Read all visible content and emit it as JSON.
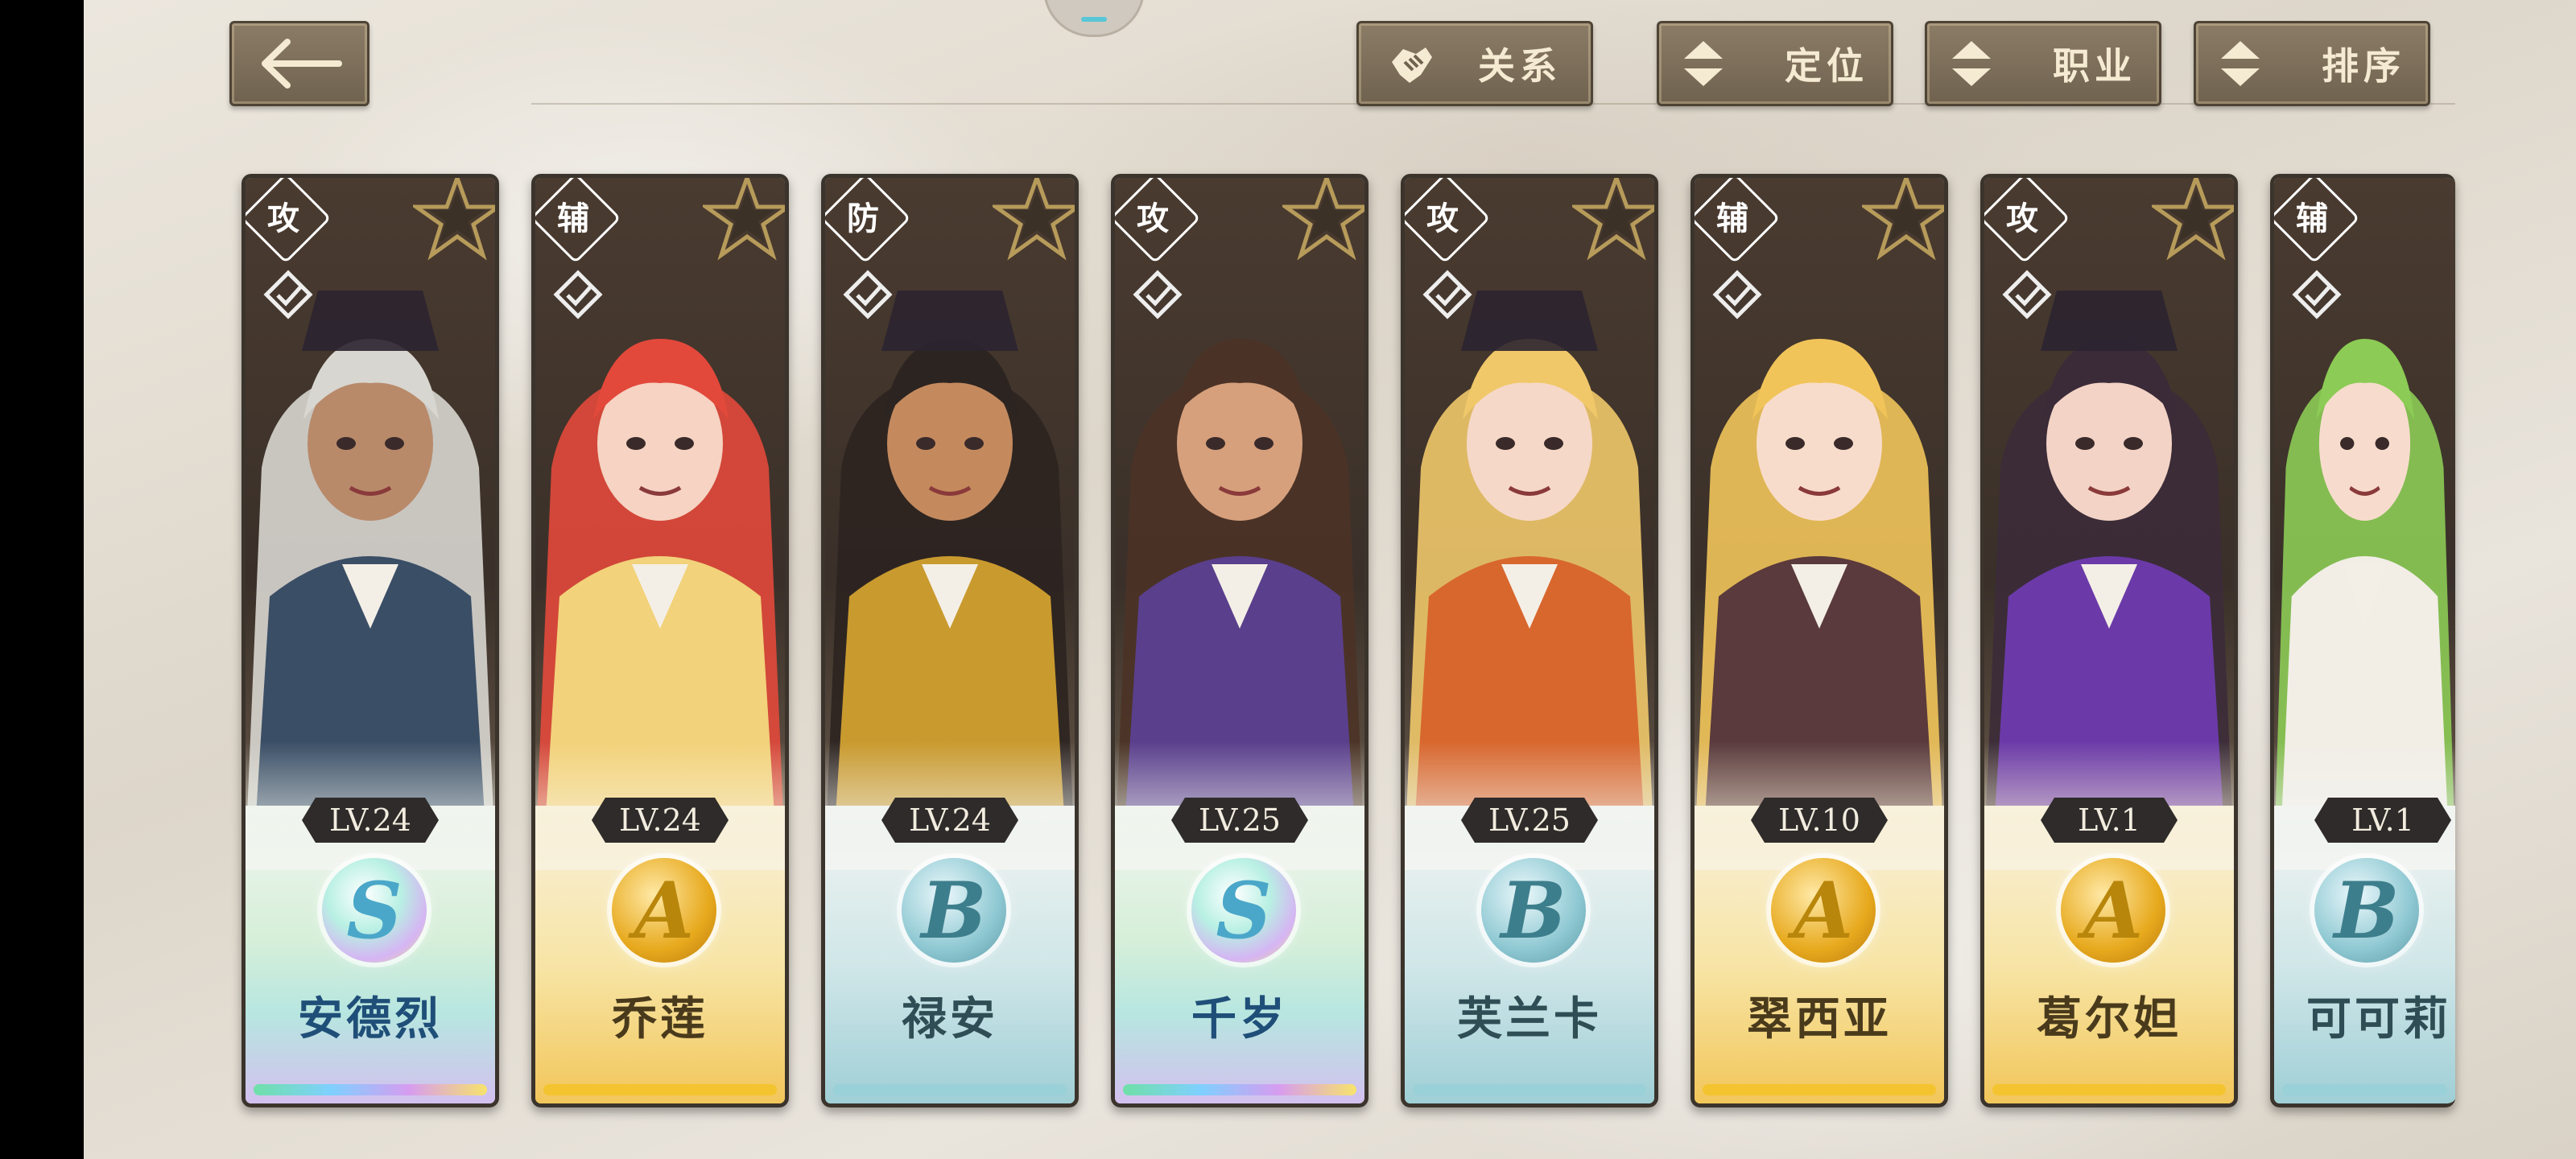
{
  "toolbar": {
    "back_icon": "arrow-left-icon",
    "relation_label": "关系",
    "position_label": "定位",
    "class_label": "职业",
    "sort_label": "排序"
  },
  "characters": [
    {
      "role": "攻",
      "level": "LV.24",
      "rank": "S",
      "name": "安德烈",
      "tier_color": "#7fd0c8",
      "skin": "#b88a6a",
      "hair": "#d8d6d0",
      "coat": "#3a4e66"
    },
    {
      "role": "辅",
      "level": "LV.24",
      "rank": "A",
      "name": "乔莲",
      "tier_color": "#f0c24a",
      "skin": "#f6d3c2",
      "hair": "#e2493b",
      "coat": "#f2d27a"
    },
    {
      "role": "防",
      "level": "LV.24",
      "rank": "B",
      "name": "禄安",
      "tier_color": "#8fc6cf",
      "skin": "#c48a5e",
      "hair": "#2c2420",
      "coat": "#c99a2e"
    },
    {
      "role": "攻",
      "level": "LV.25",
      "rank": "S",
      "name": "千岁",
      "tier_color": "#7fd0c8",
      "skin": "#d6a07c",
      "hair": "#4b3226",
      "coat": "#5a3f8c"
    },
    {
      "role": "攻",
      "level": "LV.25",
      "rank": "B",
      "name": "芙兰卡",
      "tier_color": "#8fc6cf",
      "skin": "#f6d8c8",
      "hair": "#f0c86a",
      "coat": "#d8672e"
    },
    {
      "role": "辅",
      "level": "LV.10",
      "rank": "A",
      "name": "翠西亚",
      "tier_color": "#f0c24a",
      "skin": "#f8dccb",
      "hair": "#f1c45a",
      "coat": "#5a3a3c"
    },
    {
      "role": "攻",
      "level": "LV.1",
      "rank": "A",
      "name": "葛尔妲",
      "tier_color": "#f0c24a",
      "skin": "#f3d3c6",
      "hair": "#3b2b38",
      "coat": "#6b3aa8"
    },
    {
      "role": "辅",
      "level": "LV.1",
      "rank": "B",
      "name": "可可莉",
      "tier_color": "#8fc6cf",
      "skin": "#f7dccd",
      "hair": "#8ccb55",
      "coat": "#f2eee6"
    }
  ],
  "colors": {
    "attack": "#d9542b",
    "support": "#4f9a43",
    "defense": "#3d93b3",
    "frame": "#3b342c"
  }
}
